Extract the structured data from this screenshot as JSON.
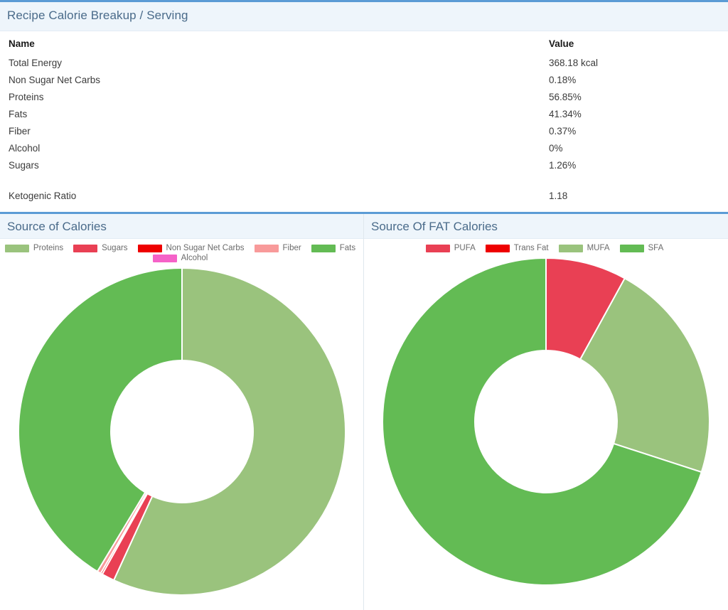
{
  "summary": {
    "title": "Recipe Calorie Breakup / Serving",
    "columns": {
      "name": "Name",
      "value": "Value"
    },
    "rows": [
      {
        "name": "Total Energy",
        "value": "368.18 kcal"
      },
      {
        "name": "Non Sugar Net Carbs",
        "value": "0.18%"
      },
      {
        "name": "Proteins",
        "value": "56.85%"
      },
      {
        "name": "Fats",
        "value": "41.34%"
      },
      {
        "name": "Fiber",
        "value": "0.37%"
      },
      {
        "name": "Alcohol",
        "value": "0%"
      },
      {
        "name": "Sugars",
        "value": "1.26%"
      }
    ],
    "ratio": {
      "name": "Ketogenic Ratio",
      "value": "1.18"
    }
  },
  "colors": {
    "accent_blue": "#5b9bd5",
    "header_bg": "#eef5fb",
    "title_text": "#4a6b8a",
    "light_green": "#9ac37d",
    "dark_green": "#63bb54",
    "crimson": "#e94054",
    "pure_red": "#ee0000",
    "salmon": "#f89a9a",
    "pink": "#f562c8"
  },
  "chart_data": [
    {
      "type": "pie",
      "title": "Source of Calories",
      "subtype": "donut",
      "legend_position": "top",
      "start_angle_deg": 0,
      "direction": "clockwise",
      "categories": [
        "Proteins",
        "Sugars",
        "Non Sugar Net Carbs",
        "Fiber",
        "Fats",
        "Alcohol"
      ],
      "values": [
        56.85,
        1.26,
        0.18,
        0.37,
        41.34,
        0
      ],
      "units": "%",
      "slice_colors": [
        "#9ac37d",
        "#e94054",
        "#ee0000",
        "#f89a9a",
        "#63bb54",
        "#f562c8"
      ],
      "draw_order": [
        "Proteins",
        "Sugars",
        "Non Sugar Net Carbs",
        "Fiber",
        "Alcohol",
        "Fats"
      ],
      "legend": [
        {
          "label": "Proteins",
          "color": "#9ac37d"
        },
        {
          "label": "Sugars",
          "color": "#e94054"
        },
        {
          "label": "Non Sugar Net Carbs",
          "color": "#ee0000"
        },
        {
          "label": "Fiber",
          "color": "#f89a9a"
        },
        {
          "label": "Fats",
          "color": "#63bb54"
        },
        {
          "label": "Alcohol",
          "color": "#f562c8"
        }
      ]
    },
    {
      "type": "pie",
      "title": "Source Of FAT Calories",
      "subtype": "donut",
      "legend_position": "top",
      "start_angle_deg": 0,
      "direction": "clockwise",
      "categories": [
        "PUFA",
        "MUFA",
        "SFA",
        "Trans Fat"
      ],
      "values": [
        8.0,
        22.0,
        70.0,
        0
      ],
      "units": "%",
      "slice_colors": [
        "#e94054",
        "#9ac37d",
        "#63bb54",
        "#ee0000"
      ],
      "draw_order": [
        "PUFA",
        "Trans Fat",
        "MUFA",
        "SFA"
      ],
      "legend": [
        {
          "label": "PUFA",
          "color": "#e94054"
        },
        {
          "label": "Trans Fat",
          "color": "#ee0000"
        },
        {
          "label": "MUFA",
          "color": "#9ac37d"
        },
        {
          "label": "SFA",
          "color": "#63bb54"
        }
      ]
    }
  ]
}
